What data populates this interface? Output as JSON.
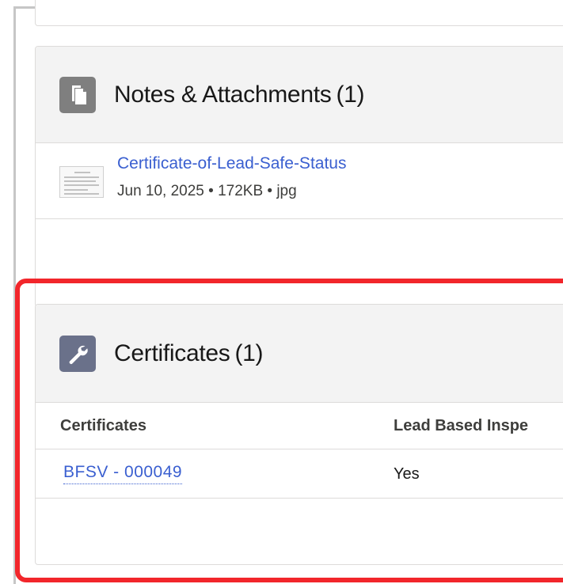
{
  "notes": {
    "title": "Notes & Attachments",
    "count": "(1)",
    "icon": "document-icon",
    "attachments": [
      {
        "title": "Certificate-of-Lead-Safe-Status",
        "meta": "Jun 10, 2025 • 172KB • jpg"
      }
    ]
  },
  "certificates": {
    "title": "Certificates",
    "count": "(1)",
    "icon": "wrench-icon",
    "columns": [
      "Certificates",
      "Lead Based Inspe"
    ],
    "rows": [
      {
        "certificate": "BFSV - 000049",
        "lead_based_inspection": "Yes"
      }
    ]
  },
  "colors": {
    "link": "#3a5fd0",
    "highlight": "#f2262b",
    "notes_icon_bg": "#7f7f7f",
    "certificates_icon_bg": "#6a718a"
  }
}
